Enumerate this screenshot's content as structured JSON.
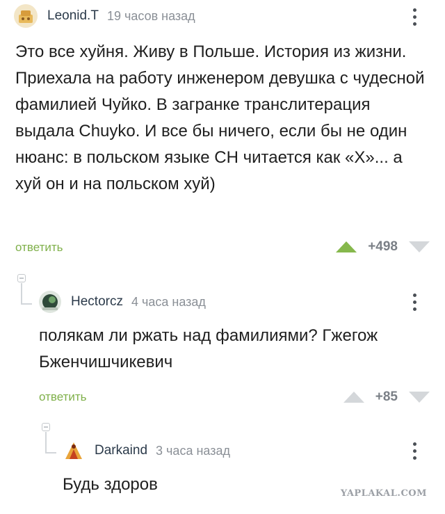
{
  "comments": [
    {
      "author": "Leonid.T",
      "time": "19 часов назад",
      "text": "Это все хуйня. Живу в Польше. История из жизни. Приехала на работу инженером девушка с чудесной фамилией Чуйко. В загранке транслитерация выдала Chuyko. И все бы ничего, если бы не один нюанс: в польском языке CH читается как «Х»... а хуй он и на польском хуй)",
      "reply_label": "ответить",
      "score": "+498",
      "upvoted": true
    },
    {
      "author": "Hectorcz",
      "time": "4 часа назад",
      "text": "полякам ли ржать над фамилиями? Гжегож Бженчишчикевич",
      "reply_label": "ответить",
      "score": "+85",
      "upvoted": false
    },
    {
      "author": "Darkaind",
      "time": "3 часа назад",
      "text": "Будь здоров"
    }
  ],
  "watermark": "YAPLAKAL.COM",
  "colors": {
    "reply_link": "#7fb04a",
    "upvote_active": "#86b84c",
    "vote_inactive": "#d4d7da",
    "meta_text": "#8a8f96"
  },
  "icons": [
    "more-vertical-icon",
    "upvote-icon",
    "downvote-icon",
    "collapse-icon"
  ]
}
